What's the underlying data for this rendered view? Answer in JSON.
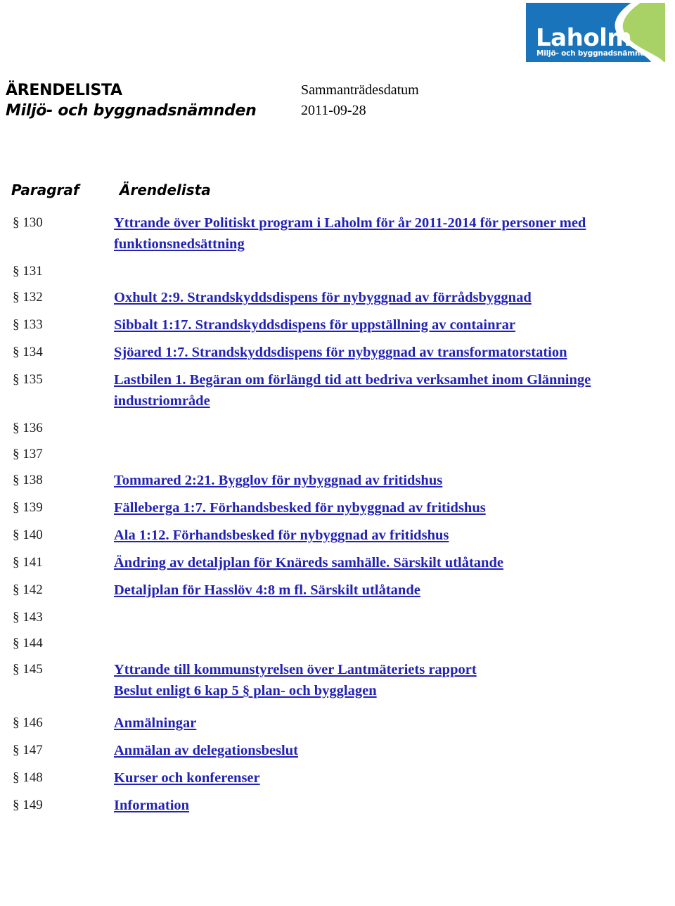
{
  "logo": {
    "wordmark": "Laholm",
    "subtitle": "Miljö- och byggnadsnämnd",
    "blue": "#1a74bb",
    "green": "#a9d266",
    "swoosh": "#ffffff"
  },
  "header": {
    "doc_type": "ÄRENDELISTA",
    "committee": "Miljö- och byggnadsnämnden",
    "date_label": "Sammanträdesdatum",
    "date_value": "2011-09-28"
  },
  "columns": {
    "paragraph": "Paragraf",
    "agenda": "Ärendelista"
  },
  "link_color": "#2222b4",
  "rows": [
    {
      "paragraph": "§ 130",
      "lines": [
        "Yttrande över Politiskt program i Laholm för år 2011-2014 för personer med funktionsnedsättning"
      ],
      "link": true
    },
    {
      "paragraph": "§ 131",
      "lines": [],
      "link": false
    },
    {
      "paragraph": "§ 132",
      "lines": [
        "Oxhult 2:9. Strandskyddsdispens för nybyggnad av förrådsbyggnad"
      ],
      "link": true
    },
    {
      "paragraph": "§ 133",
      "lines": [
        "Sibbalt 1:17. Strandskyddsdispens för uppställning av containrar"
      ],
      "link": true
    },
    {
      "paragraph": "§ 134",
      "lines": [
        "Sjöared 1:7. Strandskyddsdispens för nybyggnad av transformatorstation"
      ],
      "link": true
    },
    {
      "paragraph": "§ 135",
      "lines": [
        "Lastbilen 1. Begäran om förlängd tid att bedriva verksamhet inom Glänninge industriområde"
      ],
      "link": true
    },
    {
      "paragraph": "§ 136",
      "lines": [],
      "link": false
    },
    {
      "paragraph": "§ 137",
      "lines": [],
      "link": false
    },
    {
      "paragraph": "§ 138",
      "lines": [
        "Tommared 2:21. Bygglov för nybyggnad av fritidshus"
      ],
      "link": true
    },
    {
      "paragraph": "§ 139",
      "lines": [
        "Fälleberga 1:7. Förhandsbesked för nybyggnad av fritidshus"
      ],
      "link": true
    },
    {
      "paragraph": "§ 140",
      "lines": [
        "Ala 1:12. Förhandsbesked för nybyggnad av fritidshus"
      ],
      "link": true
    },
    {
      "paragraph": "§ 141",
      "lines": [
        "Ändring av detaljplan för Knäreds samhälle. Särskilt utlåtande"
      ],
      "link": true
    },
    {
      "paragraph": "§ 142",
      "lines": [
        "Detaljplan för Hasslöv 4:8 m fl. Särskilt utlåtande"
      ],
      "link": true
    },
    {
      "paragraph": "§ 143",
      "lines": [],
      "link": false
    },
    {
      "paragraph": "§ 144",
      "lines": [],
      "link": false
    },
    {
      "paragraph": "§ 145",
      "lines": [
        "Yttrande till kommunstyrelsen över Lantmäteriets rapport",
        "Beslut enligt 6 kap 5 § plan- och bygglagen"
      ],
      "link": true
    },
    {
      "paragraph": "§ 146",
      "lines": [
        "Anmälningar"
      ],
      "link": true
    },
    {
      "paragraph": "§ 147",
      "lines": [
        "Anmälan av delegationsbeslut"
      ],
      "link": true
    },
    {
      "paragraph": "§ 148",
      "lines": [
        "Kurser och konferenser"
      ],
      "link": true
    },
    {
      "paragraph": "§ 149",
      "lines": [
        "Information"
      ],
      "link": true
    }
  ]
}
